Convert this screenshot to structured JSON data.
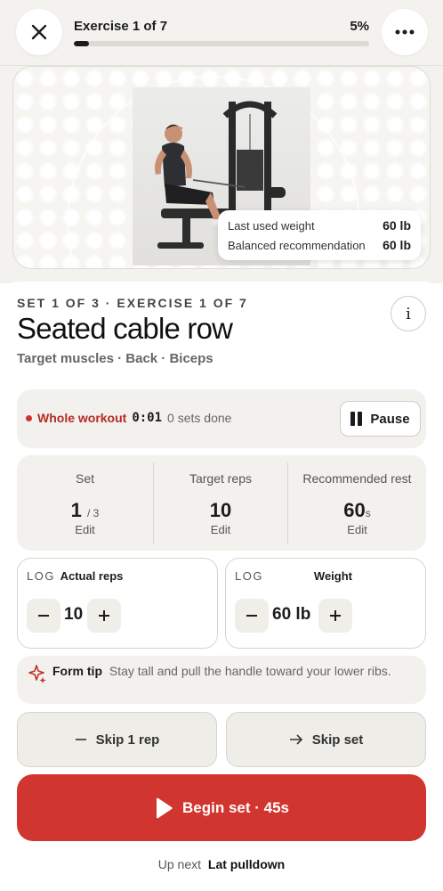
{
  "header": {
    "progress_label": "Exercise 1 of 7",
    "progress_percent_text": "5%",
    "progress_fraction": 0.05
  },
  "hero": {
    "last_used_label": "Last used weight",
    "last_used_value": "60 lb",
    "recommendation_label": "Balanced recommendation",
    "recommendation_value": "60 lb"
  },
  "exercise": {
    "eyebrow": "SET 1 OF 3 · EXERCISE 1 OF 7",
    "name": "Seated cable row",
    "muscles": "Target muscles · Back · Biceps",
    "info_label": "i"
  },
  "timer": {
    "label": "Whole workout",
    "value": "0:01",
    "sets_done": "0 sets done",
    "pause_label": "Pause"
  },
  "stats": {
    "set_label": "Set",
    "set_value": "1",
    "set_total": "/ 3",
    "set_edit": "Edit",
    "reps_label": "Target reps",
    "reps_value": "10",
    "reps_edit": "Edit",
    "rest_label": "Recommended rest",
    "rest_value": "60",
    "rest_unit": "s",
    "rest_edit": "Edit"
  },
  "log": {
    "tag": "LOG",
    "reps_title": "Actual reps",
    "reps_value": "10",
    "weight_title": "Weight",
    "weight_value": "60 lb"
  },
  "tip": {
    "title": "Form tip",
    "text": "Stay tall and pull the handle toward your lower ribs."
  },
  "actions": {
    "skip_rep": "Skip 1 rep",
    "skip_set": "Skip set",
    "begin": "Begin set · 45s"
  },
  "upnext": {
    "label": "Up next",
    "exercise": "Lat pulldown"
  },
  "colors": {
    "accent": "#d13530",
    "background": "#f3f2ee"
  }
}
